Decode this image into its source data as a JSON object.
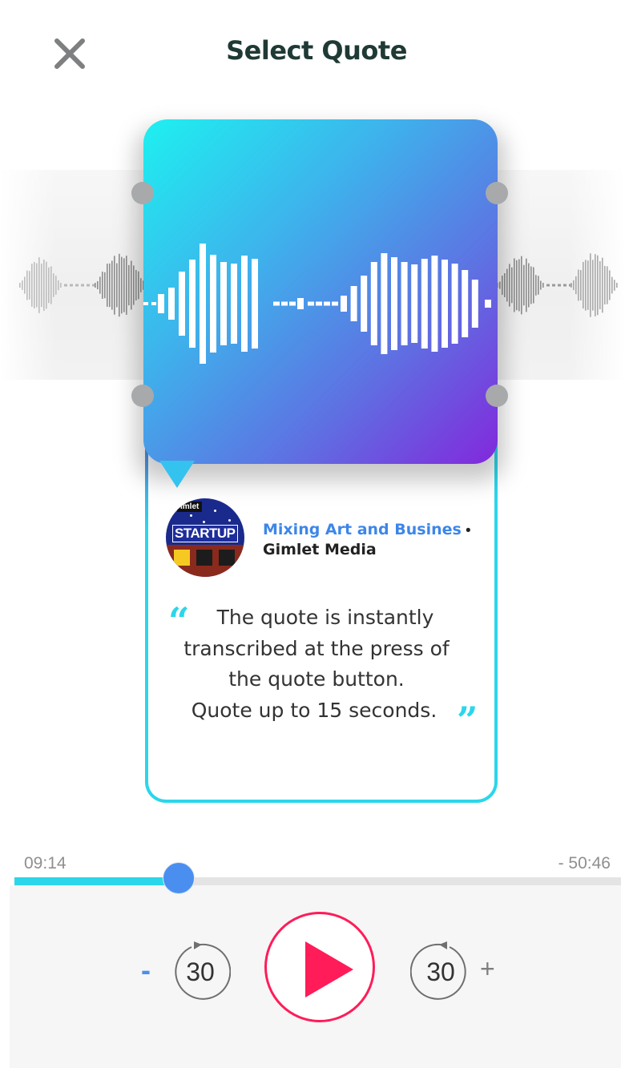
{
  "header": {
    "title": "Select Quote",
    "close_icon": "close-icon"
  },
  "episode": {
    "title": "Mixing Art and Busines",
    "separator": "•",
    "publisher": "Gimlet Media",
    "artwork": {
      "brand_text": "imlet",
      "show_text": "STARTUP"
    }
  },
  "quote": {
    "open_mark": "“",
    "close_mark": "”",
    "lines": [
      "The quote is instantly",
      "transcribed at the press of",
      "the quote button.",
      "Quote up to 15 seconds."
    ]
  },
  "player": {
    "elapsed": "09:14",
    "remaining": "- 50:46",
    "progress": 0.271,
    "skip_back_label": "30",
    "skip_forward_label": "30",
    "decrease_label": "-",
    "increase_label": "+"
  },
  "colors": {
    "accent_cyan": "#2bd6ea",
    "accent_blue": "#4a8ff0",
    "play_red": "#ff1c58",
    "title_text": "#1f3a35"
  }
}
